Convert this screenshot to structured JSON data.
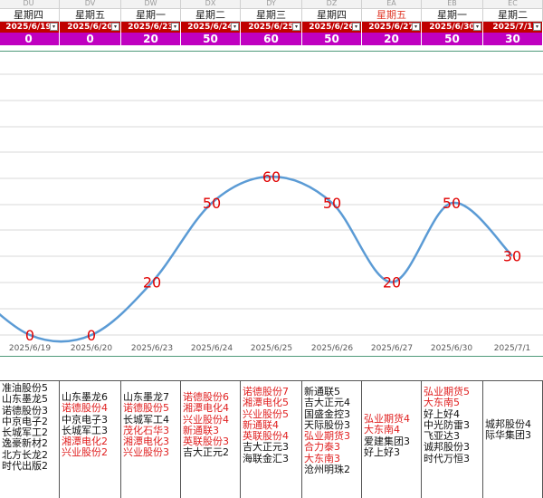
{
  "columns": [
    {
      "col": "DU",
      "day": "星期四",
      "date": "2025/6/19",
      "value": "0",
      "day_red": false
    },
    {
      "col": "DV",
      "day": "星期五",
      "date": "2025/6/20",
      "value": "0",
      "day_red": false
    },
    {
      "col": "DW",
      "day": "星期一",
      "date": "2025/6/23",
      "value": "20",
      "day_red": false
    },
    {
      "col": "DX",
      "day": "星期二",
      "date": "2025/6/24",
      "value": "50",
      "day_red": false
    },
    {
      "col": "DY",
      "day": "星期三",
      "date": "2025/6/25",
      "value": "60",
      "day_red": false
    },
    {
      "col": "DZ",
      "day": "星期四",
      "date": "2025/6/26",
      "value": "50",
      "day_red": false
    },
    {
      "col": "EA",
      "day": "星期五",
      "date": "2025/6/27",
      "value": "20",
      "day_red": true
    },
    {
      "col": "EB",
      "day": "星期一",
      "date": "2025/6/30",
      "value": "50",
      "day_red": false
    },
    {
      "col": "EC",
      "day": "星期二",
      "date": "2025/7/1",
      "value": "30",
      "day_red": false
    }
  ],
  "chart_data": {
    "type": "line",
    "x": [
      "2025/6/19",
      "2025/6/20",
      "2025/6/23",
      "2025/6/24",
      "2025/6/25",
      "2025/6/26",
      "2025/6/27",
      "2025/6/30",
      "2025/7/1"
    ],
    "values": [
      0,
      0,
      20,
      50,
      60,
      50,
      20,
      50,
      30
    ],
    "line_color": "#5b9bd5",
    "label_color": "#e00000",
    "grid": true,
    "smooth": true
  },
  "stock_lists": [
    [
      {
        "text": "准油股份5",
        "red": false
      },
      {
        "text": "山东墨龙5",
        "red": false
      },
      {
        "text": "诺德股份3",
        "red": false
      },
      {
        "text": "中京电子2",
        "red": false
      },
      {
        "text": "长城军工2",
        "red": false
      },
      {
        "text": "逸豪新材2",
        "red": false
      },
      {
        "text": "北方长龙2",
        "red": false
      },
      {
        "text": "时代出版2",
        "red": false
      }
    ],
    [
      {
        "text": "山东墨龙6",
        "red": false
      },
      {
        "text": "诺德股份4",
        "red": true
      },
      {
        "text": "中京电子3",
        "red": false
      },
      {
        "text": "长城军工3",
        "red": false
      },
      {
        "text": "湘潭电化2",
        "red": true
      },
      {
        "text": "兴业股份2",
        "red": true
      }
    ],
    [
      {
        "text": "山东墨龙7",
        "red": false
      },
      {
        "text": "诺德股份5",
        "red": true
      },
      {
        "text": "长城军工4",
        "red": false
      },
      {
        "text": "茂化石华3",
        "red": true
      },
      {
        "text": "湘潭电化3",
        "red": true
      },
      {
        "text": "兴业股份3",
        "red": true
      }
    ],
    [
      {
        "text": "诺德股份6",
        "red": true
      },
      {
        "text": "湘潭电化4",
        "red": true
      },
      {
        "text": "兴业股份4",
        "red": true
      },
      {
        "text": "新通联3",
        "red": true
      },
      {
        "text": "英联股份3",
        "red": true
      },
      {
        "text": "吉大正元2",
        "red": false
      }
    ],
    [
      {
        "text": "诺德股份7",
        "red": true
      },
      {
        "text": "湘潭电化5",
        "red": true
      },
      {
        "text": "兴业股份5",
        "red": true
      },
      {
        "text": "新通联4",
        "red": true
      },
      {
        "text": "英联股份4",
        "red": true
      },
      {
        "text": "吉大正元3",
        "red": false
      },
      {
        "text": "海联金汇3",
        "red": false
      }
    ],
    [
      {
        "text": "新通联5",
        "red": false
      },
      {
        "text": "吉大正元4",
        "red": false
      },
      {
        "text": "国盛金控3",
        "red": false
      },
      {
        "text": "天际股份3",
        "red": false
      },
      {
        "text": "弘业期货3",
        "red": true
      },
      {
        "text": "合力泰3",
        "red": true
      },
      {
        "text": "大东南3",
        "red": true
      },
      {
        "text": "沧州明珠2",
        "red": false
      }
    ],
    [
      {
        "text": "弘业期货4",
        "red": true
      },
      {
        "text": "大东南4",
        "red": true
      },
      {
        "text": "爱建集团3",
        "red": false
      },
      {
        "text": "好上好3",
        "red": false
      }
    ],
    [
      {
        "text": "弘业期货5",
        "red": true
      },
      {
        "text": "大东南5",
        "red": true
      },
      {
        "text": "好上好4",
        "red": false
      },
      {
        "text": "中光防雷3",
        "red": false
      },
      {
        "text": "飞亚达3",
        "red": false
      },
      {
        "text": "诚邦股份3",
        "red": false
      },
      {
        "text": "时代万恒3",
        "red": false
      }
    ],
    [
      {
        "text": "城邦股份4",
        "red": false
      },
      {
        "text": "际华集团3",
        "red": false
      }
    ]
  ]
}
